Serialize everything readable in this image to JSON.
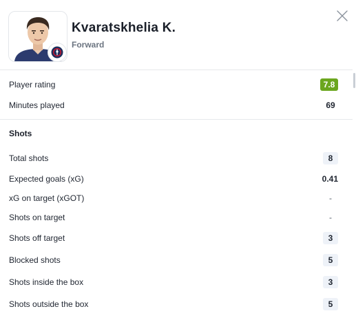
{
  "player": {
    "name": "Kvaratskhelia K.",
    "position": "Forward",
    "club_badge_icon": "psg-club-badge-icon"
  },
  "summary": [
    {
      "label": "Player rating",
      "value": "7.8",
      "style": "rating"
    },
    {
      "label": "Minutes played",
      "value": "69",
      "style": "plain"
    }
  ],
  "shots": {
    "title": "Shots",
    "rows": [
      {
        "label": "Total shots",
        "value": "8",
        "style": "boxed"
      },
      {
        "label": "Expected goals (xG)",
        "value": "0.41",
        "style": "plain"
      },
      {
        "label": "xG on target (xGOT)",
        "value": "-",
        "style": "dash"
      },
      {
        "label": "Shots on target",
        "value": "-",
        "style": "dash"
      },
      {
        "label": "Shots off target",
        "value": "3",
        "style": "boxed"
      },
      {
        "label": "Blocked shots",
        "value": "5",
        "style": "boxed"
      },
      {
        "label": "Shots inside the box",
        "value": "3",
        "style": "boxed"
      },
      {
        "label": "Shots outside the box",
        "value": "5",
        "style": "boxed"
      }
    ]
  },
  "colors": {
    "rating_bg": "#6ba61e",
    "value_box_bg": "#eef2f8",
    "club_navy": "#1b2f5c",
    "club_red": "#d0142c"
  }
}
